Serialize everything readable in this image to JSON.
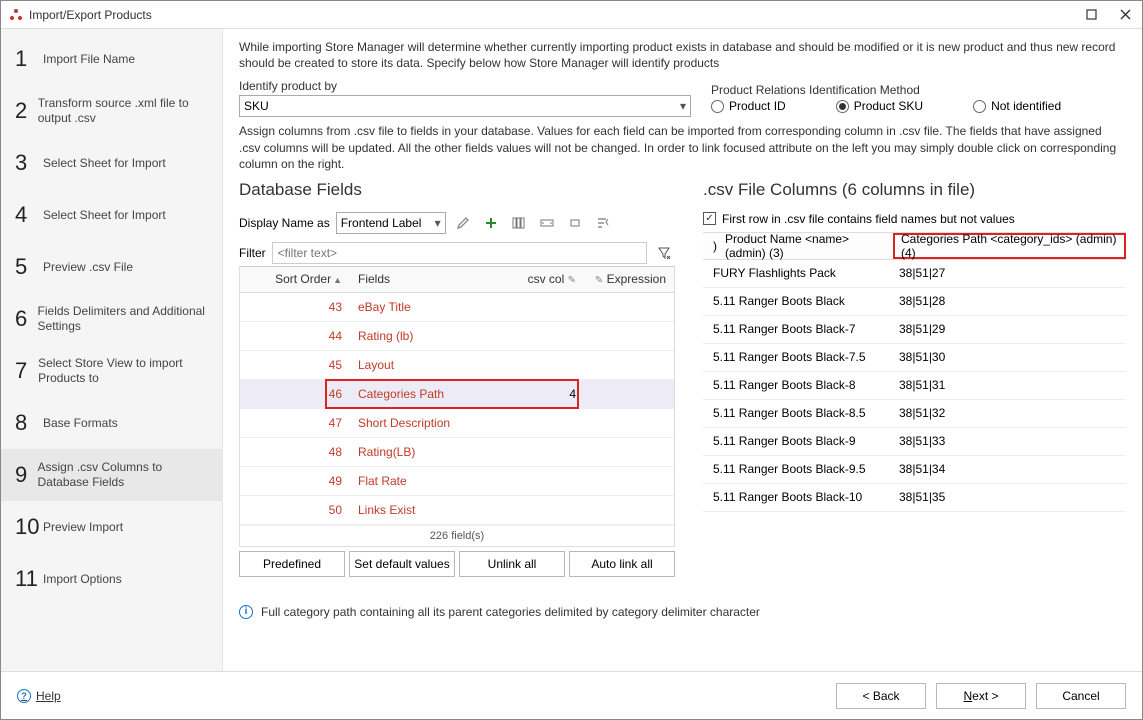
{
  "window": {
    "title": "Import/Export Products"
  },
  "sidebar": {
    "steps": [
      {
        "num": "1",
        "label": "Import File Name"
      },
      {
        "num": "2",
        "label": "Transform source .xml file to output .csv"
      },
      {
        "num": "3",
        "label": "Select Sheet for Import"
      },
      {
        "num": "4",
        "label": "Select Sheet for Import"
      },
      {
        "num": "5",
        "label": "Preview .csv File"
      },
      {
        "num": "6",
        "label": "Fields Delimiters and Additional Settings"
      },
      {
        "num": "7",
        "label": "Select Store View to import Products to"
      },
      {
        "num": "8",
        "label": "Base Formats"
      },
      {
        "num": "9",
        "label": "Assign .csv Columns to Database Fields"
      },
      {
        "num": "10",
        "label": "Preview Import"
      },
      {
        "num": "11",
        "label": "Import Options"
      }
    ],
    "active_index": 8
  },
  "intro": "While importing Store Manager will determine whether currently importing product exists in database and should be modified or it is new product and thus new record should be created to store its data. Specify below how Store Manager will identify products",
  "identify_label": "Identify product by",
  "identify_value": "SKU",
  "relations_label": "Product Relations Identification Method",
  "relations_options": [
    {
      "label": "Product ID",
      "checked": false
    },
    {
      "label": "Product SKU",
      "checked": true
    },
    {
      "label": "Not identified",
      "checked": false
    }
  ],
  "assign_desc": "Assign columns from .csv file to fields in your database. Values for each field can be imported from corresponding column in .csv file. The fields that have assigned .csv columns will be updated. All the other fields values will not be changed. In order to link focused attribute on the left you may simply double click on corresponding column on the right.",
  "left": {
    "title": "Database Fields",
    "display_label": "Display Name as",
    "display_value": "Frontend Label",
    "filter_label": "Filter",
    "filter_placeholder": "<filter text>",
    "cols": {
      "sort": "Sort Order",
      "fields": "Fields",
      "csv": "csv col",
      "exp": "Expression"
    },
    "rows": [
      {
        "sort": "43",
        "field": "eBay Title",
        "csv": "",
        "selected": false,
        "highlight": false
      },
      {
        "sort": "44",
        "field": "Rating (lb)",
        "csv": "",
        "selected": false,
        "highlight": false
      },
      {
        "sort": "45",
        "field": "Layout",
        "csv": "",
        "selected": false,
        "highlight": false
      },
      {
        "sort": "46",
        "field": "Categories Path",
        "csv": "4",
        "selected": true,
        "highlight": true
      },
      {
        "sort": "47",
        "field": "Short Description",
        "csv": "",
        "selected": false,
        "highlight": false
      },
      {
        "sort": "48",
        "field": "Rating(LB)",
        "csv": "",
        "selected": false,
        "highlight": false
      },
      {
        "sort": "49",
        "field": "Flat Rate",
        "csv": "",
        "selected": false,
        "highlight": false
      },
      {
        "sort": "50",
        "field": "Links Exist",
        "csv": "",
        "selected": false,
        "highlight": false
      }
    ],
    "footer": "226 field(s)",
    "buttons": [
      "Predefined",
      "Set default values",
      "Unlink all",
      "Auto link all"
    ]
  },
  "right": {
    "title": ".csv File Columns (6 columns in file)",
    "first_row_label": "First row in .csv file contains field names but not values",
    "first_row_checked": true,
    "header_colA_prefix": ")",
    "header_colA": "Product Name <name> (admin) (3)",
    "header_colB": "Categories Path <category_ids> (admin) (4)",
    "rows": [
      {
        "a": "FURY Flashlights Pack",
        "b": "38|51|27"
      },
      {
        "a": "5.11 Ranger Boots Black",
        "b": "38|51|28"
      },
      {
        "a": "5.11 Ranger Boots Black-7",
        "b": "38|51|29"
      },
      {
        "a": "5.11 Ranger Boots Black-7.5",
        "b": "38|51|30"
      },
      {
        "a": "5.11 Ranger Boots Black-8",
        "b": "38|51|31"
      },
      {
        "a": "5.11 Ranger Boots Black-8.5",
        "b": "38|51|32"
      },
      {
        "a": "5.11 Ranger Boots Black-9",
        "b": "38|51|33"
      },
      {
        "a": "5.11 Ranger Boots Black-9.5",
        "b": "38|51|34"
      },
      {
        "a": "5.11 Ranger Boots Black-10",
        "b": "38|51|35"
      }
    ]
  },
  "info_text": "Full category path containing all its parent categories delimited by category delimiter character",
  "help_label": "Help",
  "nav": {
    "back": "< Back",
    "next": "Next >",
    "cancel": "Cancel"
  }
}
